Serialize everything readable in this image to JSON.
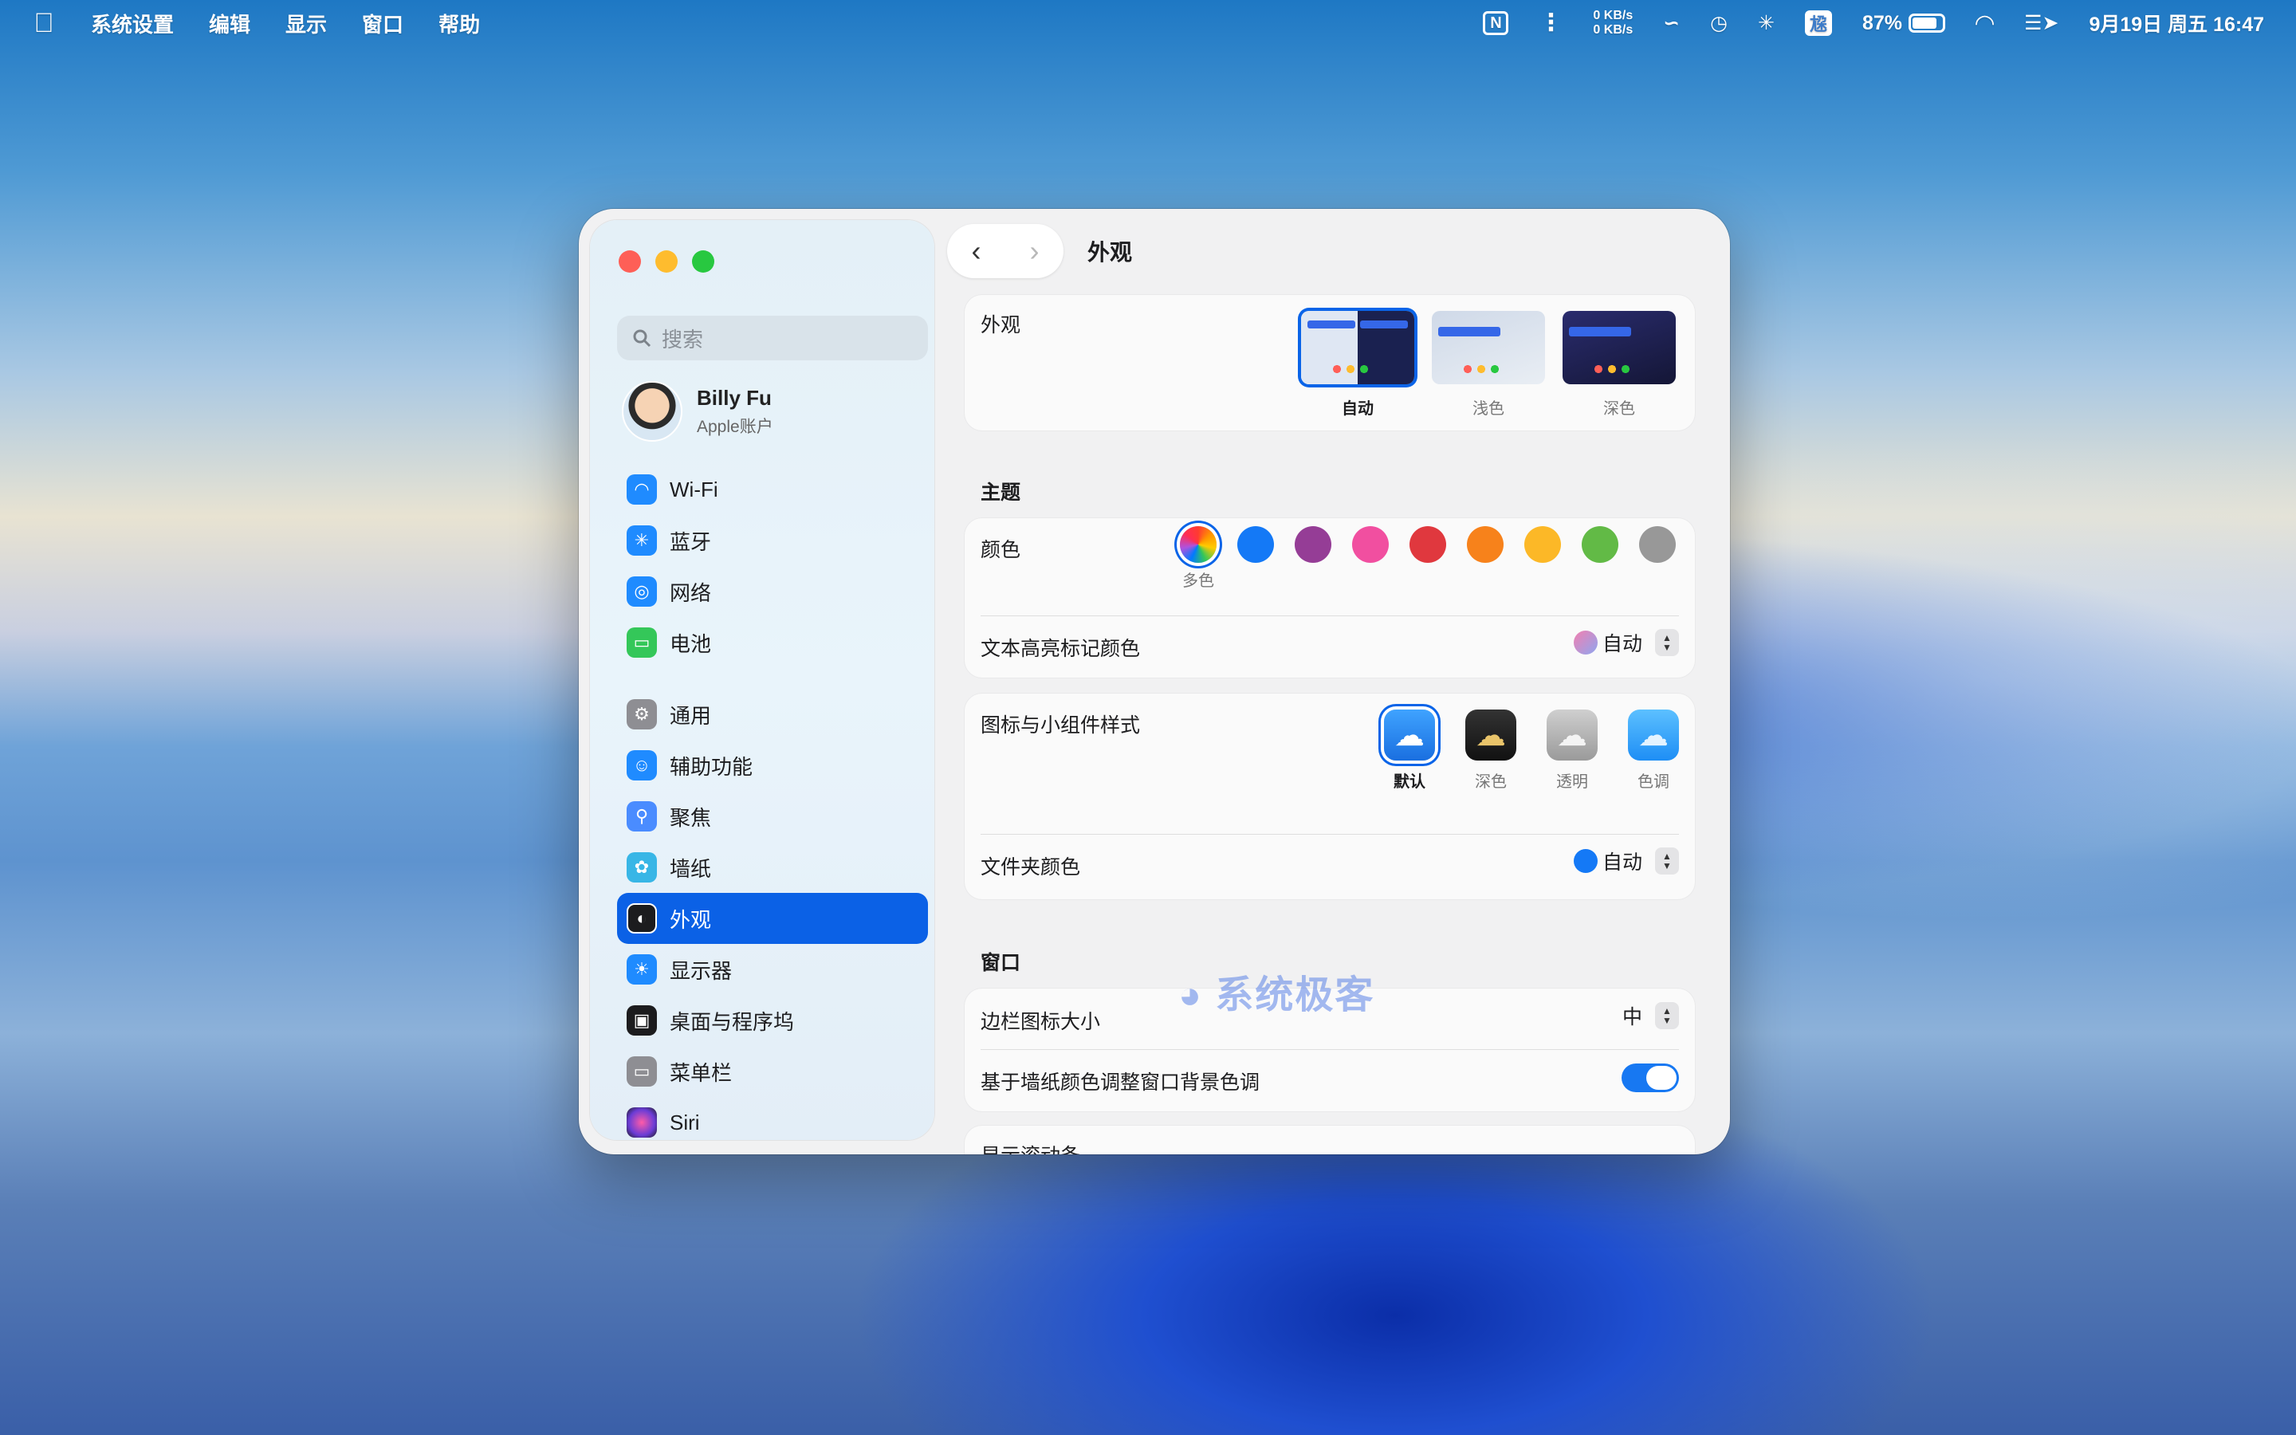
{
  "menubar": {
    "app_name": "系统设置",
    "menus": [
      "编辑",
      "显示",
      "窗口",
      "帮助"
    ],
    "net_up": "0 KB/s",
    "net_down": "0 KB/s",
    "battery": "87%",
    "datetime": "9月19日 周五  16:47"
  },
  "sidebar": {
    "search_placeholder": "搜索",
    "account": {
      "name": "Billy Fu",
      "subtitle": "Apple账户"
    },
    "items": [
      {
        "label": "Wi-Fi",
        "icon": "wifi-icon",
        "color": "#1f8bff"
      },
      {
        "label": "蓝牙",
        "icon": "bluetooth-icon",
        "color": "#1f8bff"
      },
      {
        "label": "网络",
        "icon": "globe-icon",
        "color": "#1f8bff"
      },
      {
        "label": "电池",
        "icon": "battery-icon",
        "color": "#34c759"
      },
      {
        "label": "通用",
        "icon": "gear-icon",
        "color": "#8e8e93"
      },
      {
        "label": "辅助功能",
        "icon": "accessibility-icon",
        "color": "#1f8bff"
      },
      {
        "label": "聚焦",
        "icon": "spotlight-icon",
        "color": "#4a8cff"
      },
      {
        "label": "墙纸",
        "icon": "flower-icon",
        "color": "#38b6e6"
      },
      {
        "label": "外观",
        "icon": "appearance-icon",
        "color": "#1c1c1e"
      },
      {
        "label": "显示器",
        "icon": "sun-icon",
        "color": "#1f8bff"
      },
      {
        "label": "桌面与程序坞",
        "icon": "dock-icon",
        "color": "#1c1c1e"
      },
      {
        "label": "菜单栏",
        "icon": "menubar-icon",
        "color": "#8e8e93"
      },
      {
        "label": "Siri",
        "icon": "siri-icon",
        "color": "#6a3cd6"
      }
    ],
    "active_item": "外观"
  },
  "main": {
    "title": "外观",
    "appearance": {
      "label": "外观",
      "options": [
        "自动",
        "浅色",
        "深色"
      ],
      "selected": "自动"
    },
    "theme_section": "主题",
    "color": {
      "label": "颜色",
      "swatches": [
        "multicolor",
        "#1479f6",
        "#953d96",
        "#f14fa0",
        "#e0383e",
        "#f7821b",
        "#fcb827",
        "#62ba46",
        "#989898"
      ],
      "selected_caption": "多色"
    },
    "highlight": {
      "label": "文本高亮标记颜色",
      "value": "自动"
    },
    "icon_style": {
      "label": "图标与小组件样式",
      "options": [
        "默认",
        "深色",
        "透明",
        "色调"
      ],
      "selected": "默认"
    },
    "folder_color": {
      "label": "文件夹颜色",
      "value": "自动"
    },
    "window_section": "窗口",
    "sidebar_icon_size": {
      "label": "边栏图标大小",
      "value": "中"
    },
    "wallpaper_tint": {
      "label": "基于墙纸颜色调整窗口背景色调",
      "enabled": true
    },
    "partial_row": "显示滚动条"
  },
  "watermark": "系统极客"
}
